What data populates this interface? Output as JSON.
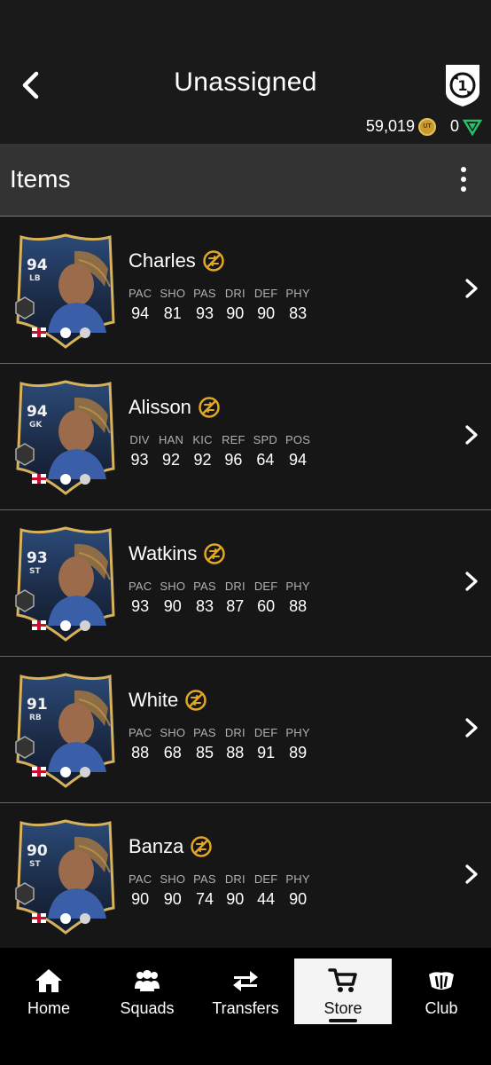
{
  "header": {
    "back_icon": "chevron-left-icon",
    "title": "Unassigned",
    "objective_badge": "1",
    "coins": "59,019",
    "coin_glyph": "UT",
    "points": "0"
  },
  "items_bar": {
    "title": "Items",
    "more_icon": "more-vertical-icon"
  },
  "players": [
    {
      "name": "Charles",
      "ovr": "94",
      "pos": "LB",
      "stat_labels": [
        "PAC",
        "SHO",
        "PAS",
        "DRI",
        "DEF",
        "PHY"
      ],
      "stat_values": [
        "94",
        "81",
        "93",
        "90",
        "90",
        "83"
      ]
    },
    {
      "name": "Alisson",
      "ovr": "94",
      "pos": "GK",
      "stat_labels": [
        "DIV",
        "HAN",
        "KIC",
        "REF",
        "SPD",
        "POS"
      ],
      "stat_values": [
        "93",
        "92",
        "92",
        "96",
        "64",
        "94"
      ]
    },
    {
      "name": "Watkins",
      "ovr": "93",
      "pos": "ST",
      "stat_labels": [
        "PAC",
        "SHO",
        "PAS",
        "DRI",
        "DEF",
        "PHY"
      ],
      "stat_values": [
        "93",
        "90",
        "83",
        "87",
        "60",
        "88"
      ]
    },
    {
      "name": "White",
      "ovr": "91",
      "pos": "RB",
      "stat_labels": [
        "PAC",
        "SHO",
        "PAS",
        "DRI",
        "DEF",
        "PHY"
      ],
      "stat_values": [
        "88",
        "68",
        "85",
        "88",
        "91",
        "89"
      ]
    },
    {
      "name": "Banza",
      "ovr": "90",
      "pos": "ST",
      "stat_labels": [
        "PAC",
        "SHO",
        "PAS",
        "DRI",
        "DEF",
        "PHY"
      ],
      "stat_values": [
        "90",
        "90",
        "74",
        "90",
        "44",
        "90"
      ]
    }
  ],
  "nav": {
    "items": [
      {
        "label": "Home",
        "icon": "home-icon"
      },
      {
        "label": "Squads",
        "icon": "squads-icon"
      },
      {
        "label": "Transfers",
        "icon": "transfers-icon"
      },
      {
        "label": "Store",
        "icon": "cart-icon"
      },
      {
        "label": "Club",
        "icon": "club-icon"
      }
    ],
    "active": "Store"
  },
  "colors": {
    "background": "#1a1a1a",
    "items_bar": "#333333",
    "gold": "#e2a823",
    "points_green": "#27c16a",
    "nav_bg": "#000000",
    "nav_active_bg": "#f4f4f4"
  }
}
